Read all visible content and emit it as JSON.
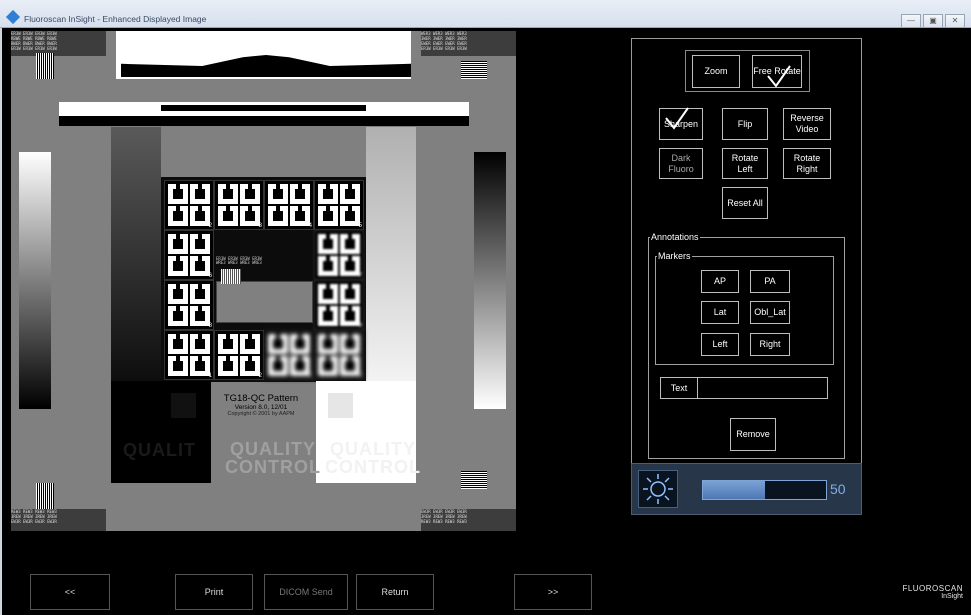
{
  "window": {
    "title": "Fluoroscan InSight - Enhanced Displayed Image",
    "buttons": [
      "minimize",
      "maximize",
      "close"
    ]
  },
  "pattern": {
    "title": "TG18-QC Pattern",
    "version": "Version 8.0, 12/01",
    "copyright": "Copyright © 2001 by AAPM",
    "qc_text": [
      "QUALITY",
      "CONTROL"
    ],
    "qc_partial": "QUALIT",
    "marker_numbers": [
      "2",
      "3",
      "4",
      "5",
      "6",
      "7",
      "8",
      "9",
      "1",
      "2",
      "3",
      "8",
      "9",
      "0"
    ]
  },
  "controls": {
    "zoom": "Zoom",
    "free_rotate": "Free Rotate",
    "sharpen": "Sharpen",
    "flip": "Flip",
    "reverse_video": "Reverse Video",
    "dark_fluoro": "Dark Fluoro",
    "rotate_left": "Rotate Left",
    "rotate_right": "Rotate Right",
    "reset_all": "Reset All"
  },
  "annotations": {
    "legend": "Annotations",
    "markers_legend": "Markers",
    "markers": [
      "AP",
      "PA",
      "Lat",
      "Obl_Lat",
      "Left",
      "Right"
    ],
    "text_label": "Text",
    "text_value": "",
    "remove": "Remove"
  },
  "brightness": {
    "value": 50,
    "value_label": "50",
    "icon": "brightness-icon"
  },
  "nav": {
    "prev": "<<",
    "print": "Print",
    "dicom_send": "DICOM Send",
    "return": "Return",
    "next": ">>"
  },
  "logo": {
    "brand": "FLUOROSCAN",
    "product": "InSight"
  }
}
